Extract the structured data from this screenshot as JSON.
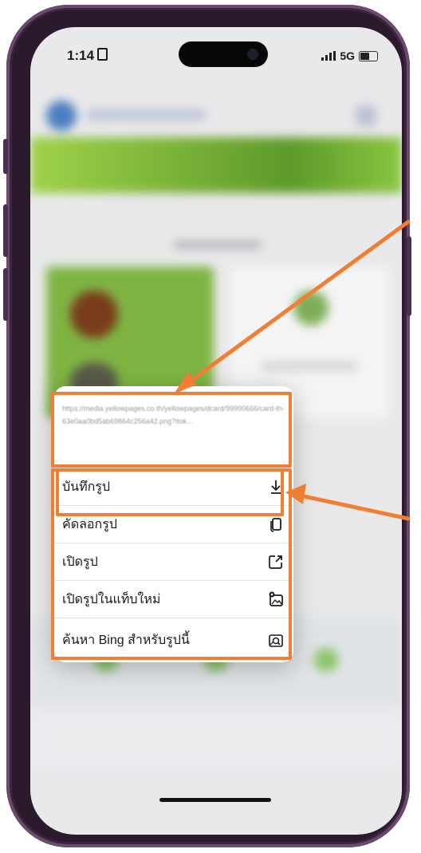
{
  "status_bar": {
    "time": "1:14",
    "signal": "5G"
  },
  "context_menu": {
    "url_preview": "https://media.yellowpages.co.th/yellowpages/dcard/99990666/card-th-63e0aa0bd5ab69864c256a42.png?itok...",
    "items": [
      {
        "label": "บันทึกรูป",
        "icon": "download-icon"
      },
      {
        "label": "คัดลอกรูป",
        "icon": "copy-icon"
      },
      {
        "label": "เปิดรูป",
        "icon": "open-external-icon"
      },
      {
        "label": "เปิดรูปในแท็บใหม่",
        "icon": "new-tab-image-icon"
      },
      {
        "label": "ค้นหา Bing สำหรับรูปนี้",
        "icon": "image-search-icon"
      }
    ]
  },
  "colors": {
    "annotation": "#f07f34",
    "frame": "#2a1a2c",
    "banner": "#7fb443"
  }
}
